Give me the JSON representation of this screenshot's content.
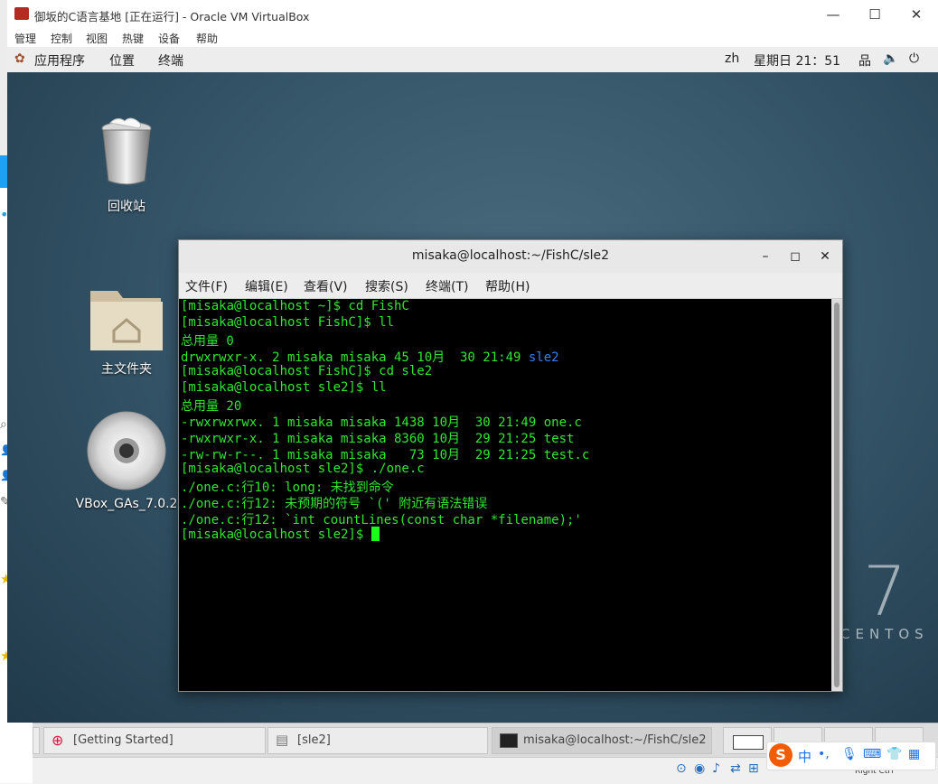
{
  "window": {
    "title": "御坂的C语言基地 [正在运行] - Oracle VM VirtualBox"
  },
  "host_menu": [
    "管理",
    "控制",
    "视图",
    "热键",
    "设备",
    "帮助"
  ],
  "gnome_bar": {
    "applications": "应用程序",
    "places": "位置",
    "terminal": "终端",
    "lang": "zh",
    "clock": "星期日 21：51"
  },
  "desktop_icons": [
    {
      "label": "回收站",
      "icon": "trash-icon"
    },
    {
      "label": "主文件夹",
      "icon": "home-folder-icon"
    },
    {
      "label": "VBox_GAs_7.0.2",
      "icon": "cd-icon"
    }
  ],
  "terminal": {
    "title": "misaka@localhost:~/FishC/sle2",
    "menu": [
      "文件(F)",
      "编辑(E)",
      "查看(V)",
      "搜索(S)",
      "终端(T)",
      "帮助(H)"
    ],
    "lines": [
      "[misaka@localhost ~]$ cd FishC",
      "[misaka@localhost FishC]$ ll",
      "总用量 0",
      {
        "pre": "drwxrwxr-x. 2 misaka misaka 45 10月  30 21:49 ",
        "dir": "sle2"
      },
      "[misaka@localhost FishC]$ cd sle2",
      "[misaka@localhost sle2]$ ll",
      "总用量 20",
      "-rwxrwxrwx. 1 misaka misaka 1438 10月  30 21:49 one.c",
      "-rwxrwxr-x. 1 misaka misaka 8360 10月  29 21:25 test",
      "-rw-rw-r--. 1 misaka misaka   73 10月  29 21:25 test.c",
      "[misaka@localhost sle2]$ ./one.c",
      "./one.c:行10: long: 未找到命令",
      "./one.c:行12: 未预期的符号 `(' 附近有语法错误",
      "./one.c:行12: `int countLines(const char *filename);'",
      "[misaka@localhost sle2]$ "
    ]
  },
  "branding": {
    "version": "7",
    "name": "CENTOS"
  },
  "taskbar": {
    "items": [
      "[Getting Started]",
      "[sle2]",
      "misaka@localhost:~/FishC/sle2"
    ]
  },
  "ime": {
    "logo": "S",
    "mode": "中"
  },
  "status": {
    "host_key": "Right Ctrl"
  },
  "colors": {
    "terminal_fg": "#33e633",
    "dir": "#3a7cff",
    "accent": "#1da1f2"
  }
}
